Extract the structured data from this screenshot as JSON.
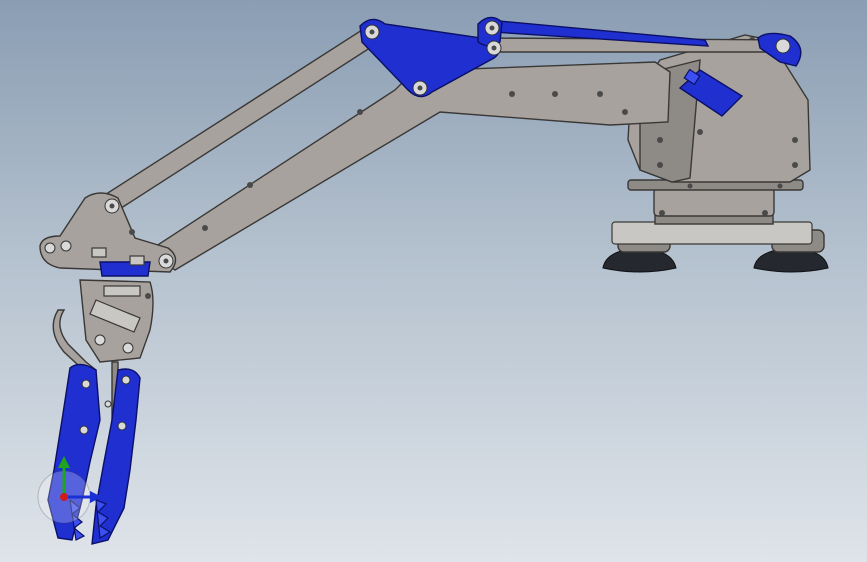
{
  "viewport": {
    "background_top": "#8a9db3",
    "background_bottom": "#dfe4ea"
  },
  "model": {
    "part_color_structure": "#a7a29d",
    "part_color_accent": "#1f2fd0",
    "part_color_feet": "#25292f"
  },
  "triad": {
    "x_axis_color": "#1a2fd6",
    "y_axis_color": "#1ea51e",
    "z_axis_color": "#d11a1a"
  },
  "icons": [
    "coordinate-triad-icon"
  ]
}
